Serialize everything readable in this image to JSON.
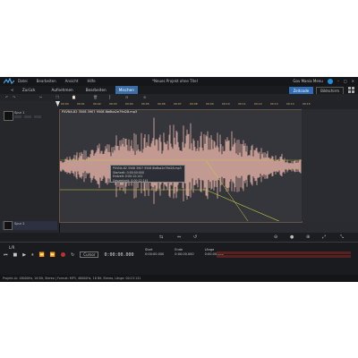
{
  "app": {
    "window_title": "*Neues Projekt ohne Titel",
    "help_label": "Gov Mania Menu"
  },
  "menu": [
    "Datei",
    "Bearbeiten",
    "Ansicht",
    "Hilfe"
  ],
  "toolbar": {
    "back_label": "Zurück",
    "tabs": [
      {
        "label": "Aufnehmen",
        "active": false
      },
      {
        "label": "Bearbeiten",
        "active": false
      },
      {
        "label": "Mischen",
        "active": true
      }
    ],
    "mode_buttons": [
      {
        "label": "Zeitcode",
        "active": true
      },
      {
        "label": "Bildschirm",
        "active": false
      }
    ]
  },
  "ruler_ticks": [
    "00:00",
    "00:01",
    "00:02",
    "00:03",
    "00:04",
    "00:05",
    "00:06",
    "00:07",
    "00:08",
    "00:09",
    "00:10",
    "00:11",
    "00:12",
    "00:13",
    "00:14",
    "00:15"
  ],
  "tracks": [
    {
      "name": "Spur 1"
    },
    {
      "name": "Spur 2"
    }
  ],
  "clip": {
    "name": "PXVN4-82 3508 3907 9508 8b6ba2e79d28.mp3",
    "tooltip_lines": [
      "PXVN4-82 3508 3907 9508 8b6ba2e79d28.mp3",
      "Startzeit: 0:00:00:000",
      "Endzeit: 0:00:12:141",
      "Gesamtzeit: 0:00:12:141"
    ]
  },
  "transport": {
    "volume_label": "L/R",
    "combo_label": "Cursor",
    "timecode": "0:00:00.000"
  },
  "stats": [
    {
      "label": "Start",
      "value": "0:00:00.000"
    },
    {
      "label": "Ende",
      "value": "0:00:00.000"
    },
    {
      "label": "Länge",
      "value": "0:00:00.000"
    }
  ],
  "status": "Projekt-Lk: 48000Hz, 16 Bit, Stereo | Format: MP3, 48000Hz, 16 Bit, Stereo, Länge: 00:15:141",
  "colors": {
    "accent": "#2f6db6",
    "waveform": "#e8b4a8",
    "envelope": "#c8d040"
  }
}
